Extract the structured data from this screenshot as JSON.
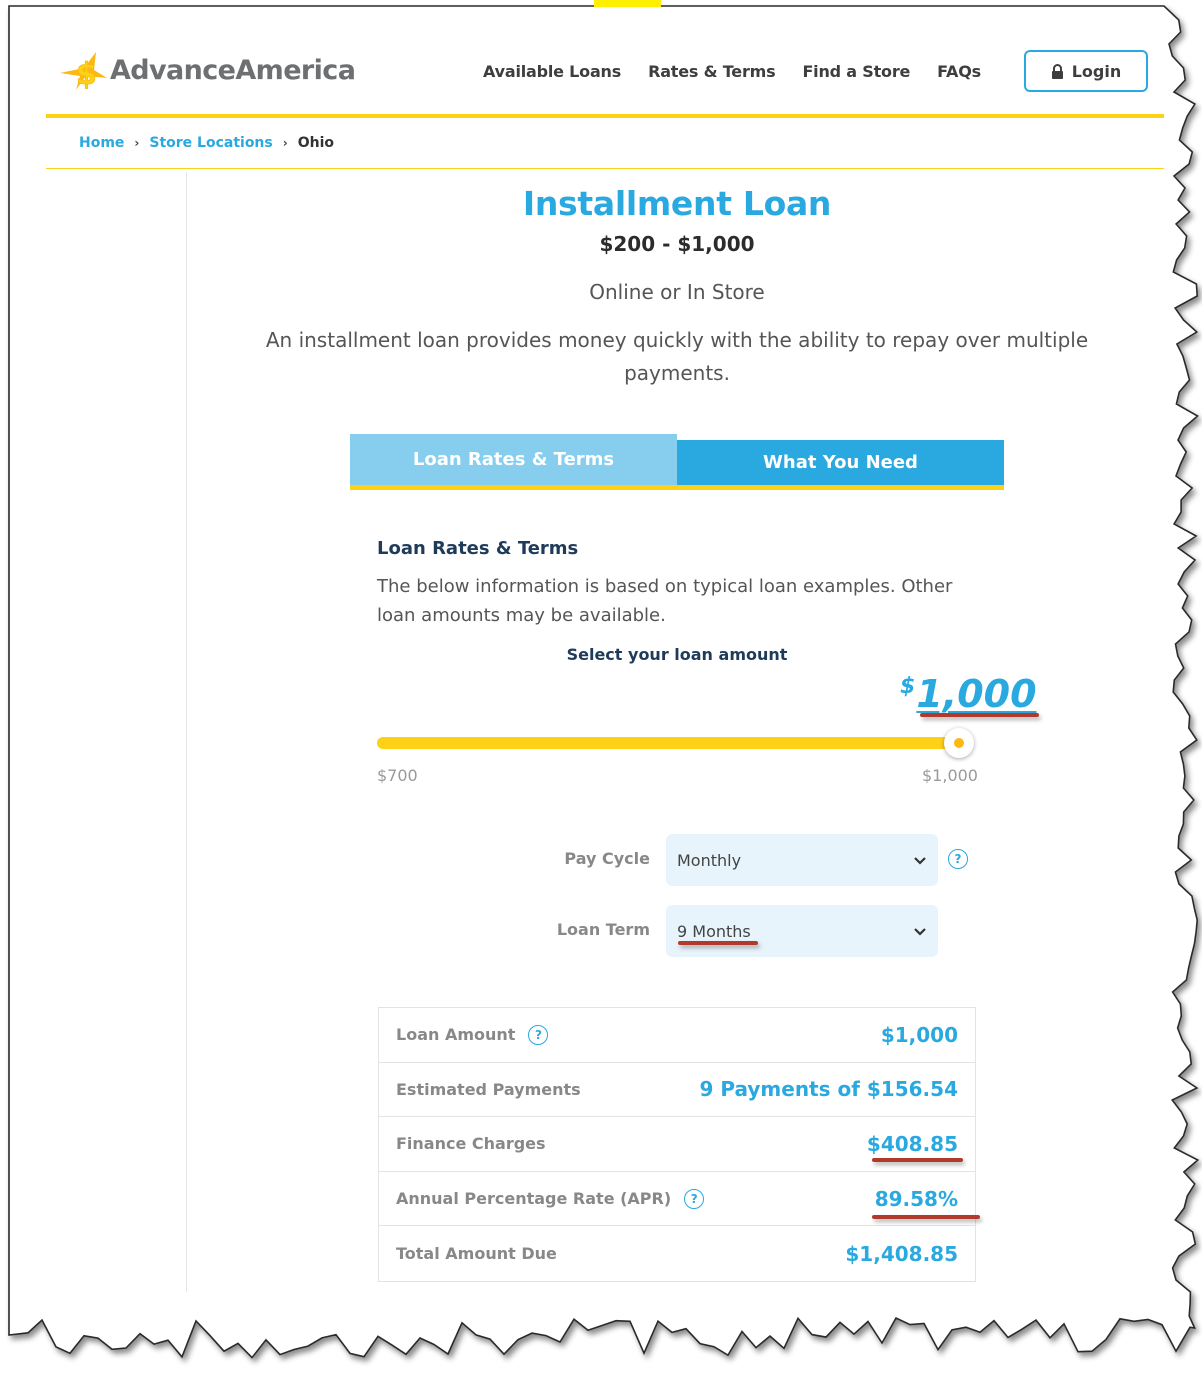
{
  "brand": {
    "name": "AdvanceAmerica",
    "colors": {
      "primary_blue": "#29a9e0",
      "light_blue": "#86cdee",
      "yellow": "#fcd116",
      "annotation_red": "#b23a2c"
    }
  },
  "nav": {
    "items": [
      {
        "label": "Available Loans"
      },
      {
        "label": "Rates & Terms"
      },
      {
        "label": "Find a Store"
      },
      {
        "label": "FAQs"
      }
    ],
    "login_label": "Login",
    "login_icon": "lock-icon"
  },
  "breadcrumb": {
    "items": [
      {
        "label": "Home"
      },
      {
        "label": "Store Locations"
      }
    ],
    "current": "Ohio",
    "separator": "›"
  },
  "product": {
    "title": "Installment Loan",
    "range": "$200 - $1,000",
    "channel": "Online or In Store",
    "description": "An installment loan provides money quickly with the ability to repay over multiple payments."
  },
  "tabs": [
    {
      "label": "Loan Rates & Terms",
      "active": true
    },
    {
      "label": "What You Need",
      "active": false
    }
  ],
  "rates_section": {
    "heading": "Loan Rates & Terms",
    "text": "The below information is based on typical loan examples. Other loan amounts may be available.",
    "select_label": "Select your loan amount"
  },
  "slider": {
    "currency": "$",
    "value_label": "1,000",
    "min_label": "$700",
    "max_label": "$1,000",
    "min": 700,
    "max": 1000,
    "value": 1000
  },
  "form": {
    "pay_cycle": {
      "label": "Pay Cycle",
      "value": "Monthly"
    },
    "loan_term": {
      "label": "Loan Term",
      "value": "9 Months"
    },
    "help_glyph": "?"
  },
  "summary": {
    "rows": [
      {
        "label": "Loan Amount",
        "value": "$1,000",
        "help": true
      },
      {
        "label": "Estimated Payments",
        "value": "9 Payments of $156.54",
        "help": false
      },
      {
        "label": "Finance Charges",
        "value": "$408.85",
        "help": false
      },
      {
        "label": "Annual Percentage Rate (APR)",
        "value": "89.58%",
        "help": true
      },
      {
        "label": "Total Amount Due",
        "value": "$1,408.85",
        "help": false
      }
    ]
  }
}
